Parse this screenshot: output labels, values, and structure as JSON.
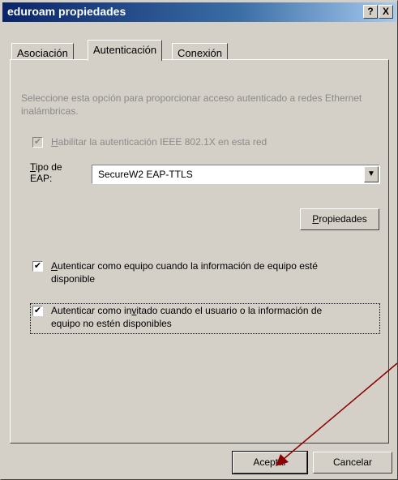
{
  "window": {
    "title": "eduroam propiedades",
    "help_glyph": "?",
    "close_glyph": "X"
  },
  "tabs": [
    {
      "label": "Asociación",
      "active": false
    },
    {
      "label": "Autenticación",
      "active": true
    },
    {
      "label": "Conexión",
      "active": false
    }
  ],
  "auth": {
    "description": "Seleccione esta opción para proporcionar acceso autenticado a redes Ethernet inalámbricas.",
    "enable_8021x": {
      "label_first": "H",
      "label_rest": "abilitar la autenticación IEEE 802.1X en esta red",
      "checked": true,
      "enabled": false
    },
    "eap_type": {
      "label_line1_first": "T",
      "label_line1_rest": "ipo de",
      "label_line2": "EAP:",
      "selected": "SecureW2 EAP-TTLS"
    },
    "properties_button": {
      "first": "P",
      "rest": "ropiedades"
    },
    "auth_as_computer": {
      "label_first": "A",
      "label_rest": "utenticar como equipo cuando la información de equipo esté",
      "label_line2": "disponible",
      "checked": true
    },
    "auth_as_guest": {
      "label_pre": "Autenticar como in",
      "label_underline": "v",
      "label_post": "itado cuando el usuario o la información de",
      "label_line2": "equipo no estén disponibles",
      "checked": true
    }
  },
  "footer": {
    "ok_label": "Aceptar",
    "cancel_label": "Cancelar"
  },
  "colors": {
    "face": "#d4d0c8",
    "title_gradient_start": "#0a246a",
    "annotation_arrow": "#8b0000"
  }
}
